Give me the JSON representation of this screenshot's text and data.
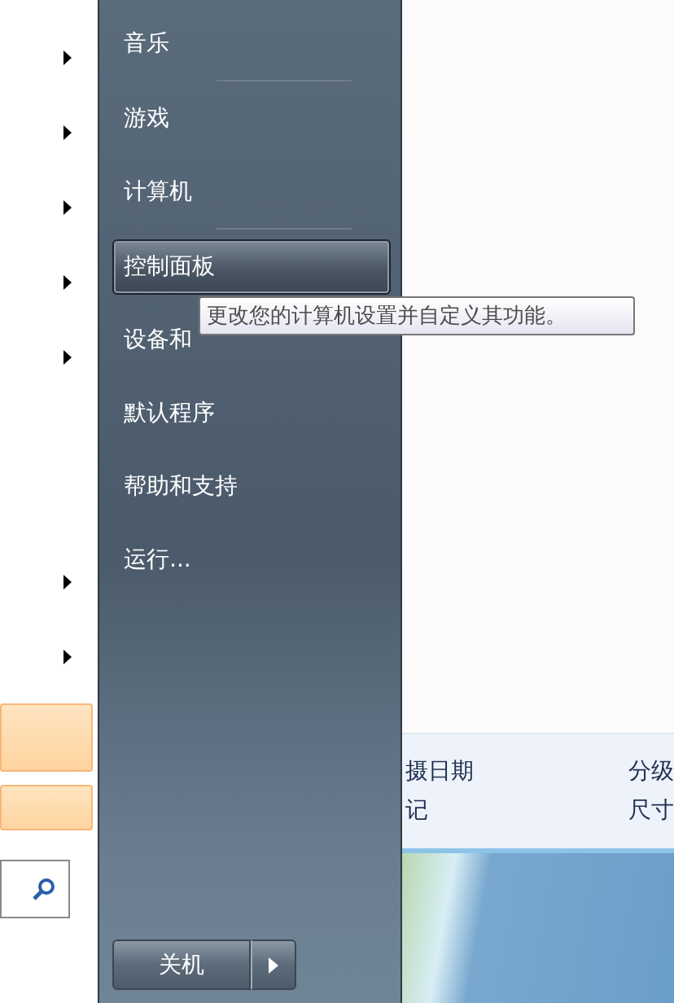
{
  "left_panel": {
    "items": [
      {
        "submenu": true
      },
      {
        "submenu": true
      },
      {
        "submenu": true
      },
      {
        "submenu": true
      },
      {
        "submenu": true
      },
      {
        "submenu": false
      },
      {
        "submenu": false
      },
      {
        "submenu": true
      },
      {
        "submenu": true
      }
    ],
    "highlighted_items": [
      {
        "highlighted": true
      },
      {
        "highlighted": true
      }
    ]
  },
  "right_menu": {
    "items": [
      {
        "kind": "item",
        "label": "音乐",
        "selected": false
      },
      {
        "kind": "separator"
      },
      {
        "kind": "item",
        "label": "游戏",
        "selected": false
      },
      {
        "kind": "item",
        "label": "计算机",
        "selected": false
      },
      {
        "kind": "separator"
      },
      {
        "kind": "item",
        "label": "控制面板",
        "selected": true
      },
      {
        "kind": "item",
        "label": "设备和",
        "selected": false
      },
      {
        "kind": "item",
        "label": "默认程序",
        "selected": false
      },
      {
        "kind": "item",
        "label": "帮助和支持",
        "selected": false
      },
      {
        "kind": "item",
        "label": "运行...",
        "selected": false
      }
    ],
    "shutdown": {
      "label": "关机"
    }
  },
  "tooltip": {
    "text": "更改您的计算机设置并自定义其功能。"
  },
  "details_pane": {
    "rows": [
      [
        "摄日期",
        "分级"
      ],
      [
        "记",
        "尺寸"
      ]
    ]
  }
}
